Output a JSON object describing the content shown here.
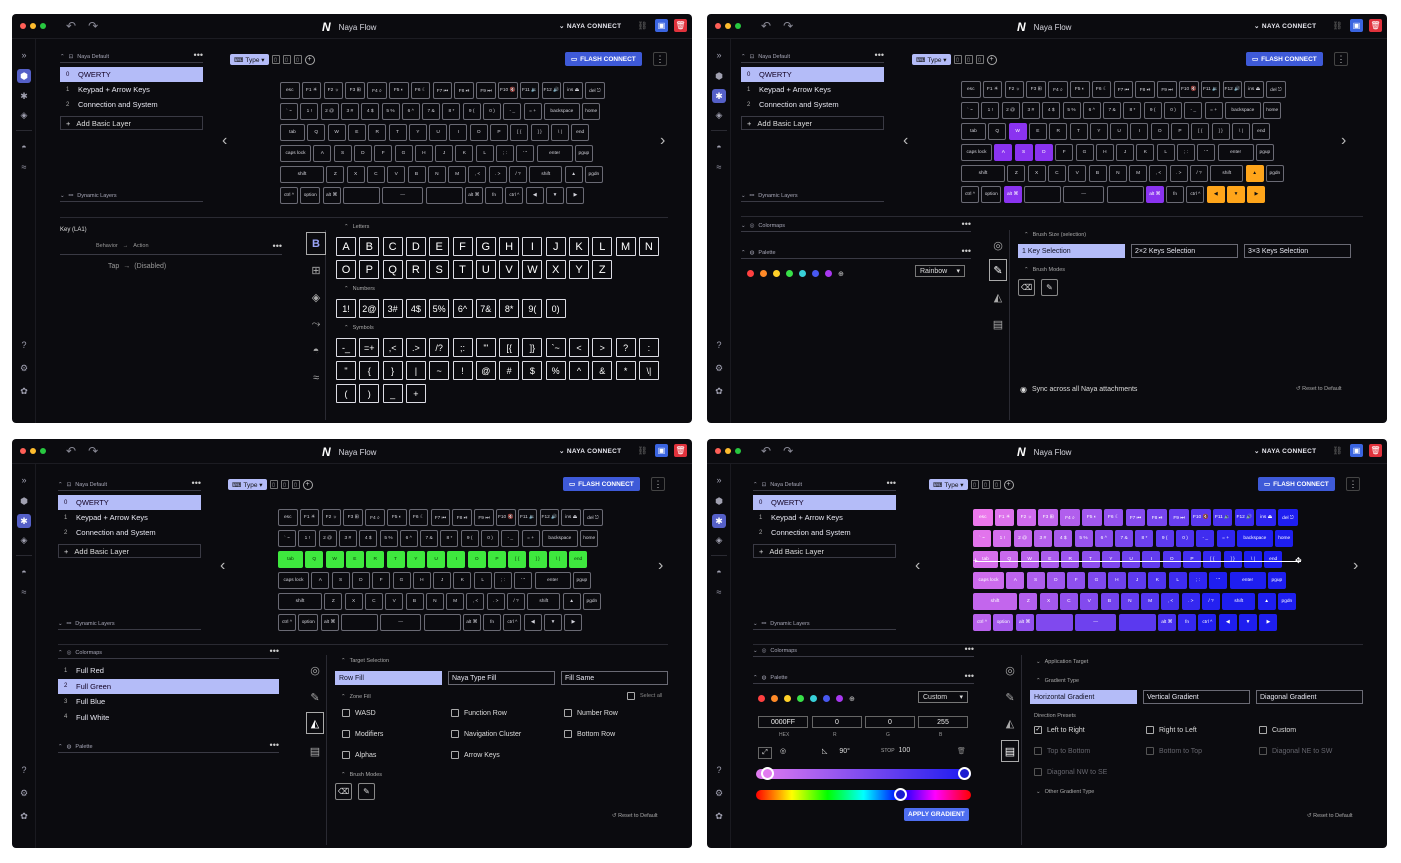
{
  "app": {
    "title": "Naya Flow",
    "logo": "N",
    "connect": "NAYA CONNECT",
    "flash": "FLASH CONNECT",
    "type_label": "Type",
    "collapse_icon": "»"
  },
  "panels": {
    "naya_default": "Naya Default",
    "dynamic_layers": "Dynamic Layers",
    "colormaps": "Colormaps",
    "palette": "Palette"
  },
  "layers": [
    {
      "n": "0",
      "label": "QWERTY"
    },
    {
      "n": "1",
      "label": "Keypad + Arrow Keys"
    },
    {
      "n": "2",
      "label": "Connection and System"
    }
  ],
  "add_layer": "Add Basic Layer",
  "keyboard": [
    [
      "esc",
      "F1 ☀",
      "F2 ☼",
      "F3 ⊞",
      "F4 ⌕",
      "F5 ◐",
      "F6 ☾",
      "F7 ⏮",
      "F8 ⏯",
      "F9 ⏭",
      "F10 🔇",
      "F11 🔉",
      "F12 🔊",
      "ins ⏏",
      "del ⎋"
    ],
    [
      "` ~",
      "1 !",
      "2 @",
      "3 #",
      "4 $",
      "5 %",
      "6 ^",
      "7 &",
      "8 *",
      "9 (",
      "0 )",
      "- _",
      "= +",
      "backspace",
      "home"
    ],
    [
      "tab",
      "Q",
      "W",
      "E",
      "R",
      "T",
      "Y",
      "U",
      "I",
      "O",
      "P",
      "[ {",
      "] }",
      "\\ |",
      "end"
    ],
    [
      "caps lock",
      "A",
      "S",
      "D",
      "F",
      "G",
      "H",
      "J",
      "K",
      "L",
      "; :",
      "' \"",
      "enter",
      "pgup"
    ],
    [
      "shift",
      "Z",
      "X",
      "C",
      "V",
      "B",
      "N",
      "M",
      ", <",
      ". >",
      "/ ?",
      "shift",
      "▲",
      "pgdn"
    ],
    [
      "ctrl ^",
      "option",
      "alt ⌘",
      "",
      "—",
      "",
      "alt ⌘",
      "fn",
      "ctrl ^",
      "◀",
      "▼",
      "▶"
    ]
  ],
  "w1": {
    "key_label": "Key (LA1)",
    "behavior": "Behavior",
    "action": "Action",
    "tap": "Tap",
    "tap_arrow": "→",
    "tap_value": "(Disabled)",
    "letters_title": "Letters",
    "numbers_title": "Numbers",
    "symbols_title": "Symbols",
    "tab_glyph": "B",
    "letters": [
      "A",
      "B",
      "C",
      "D",
      "E",
      "F",
      "G",
      "H",
      "I",
      "J",
      "K",
      "L",
      "M",
      "N",
      "O",
      "P",
      "Q",
      "R",
      "S",
      "T",
      "U",
      "V",
      "W",
      "X",
      "Y",
      "Z"
    ],
    "numbers": [
      "1!",
      "2@",
      "3#",
      "4$",
      "5%",
      "6^",
      "7&",
      "8*",
      "9(",
      "0)"
    ],
    "symbols": [
      "-_",
      "=+",
      ",<",
      ".>",
      "/?",
      ";:",
      "'\"",
      "[{",
      "]}",
      "`~",
      "<",
      ">",
      "?",
      ":",
      "\"",
      "{",
      "}",
      "|",
      "~",
      "!",
      "@",
      "#",
      "$",
      "%",
      "^",
      "&",
      "*",
      "\\|",
      "(",
      ")",
      "_",
      "+"
    ]
  },
  "w2": {
    "brush_size": "Brush Size (selection)",
    "sizes": [
      "1 Key Selection",
      "2×2 Keys Selection",
      "3×3 Keys Selection"
    ],
    "brush_modes": "Brush Modes",
    "palette_mode": "Rainbow",
    "sync": "Sync across all Naya attachments",
    "reset": "Reset to Default"
  },
  "w3": {
    "colormaps": [
      {
        "n": "1",
        "label": "Full Red"
      },
      {
        "n": "2",
        "label": "Full Green"
      },
      {
        "n": "3",
        "label": "Full Blue"
      },
      {
        "n": "4",
        "label": "Full White"
      }
    ],
    "target": "Target Selection",
    "targets": [
      "Row Fill",
      "Naya Type Fill",
      "Fill Same"
    ],
    "zone_fill": "Zone Fill",
    "select_all": "Select all",
    "zones": [
      "WASD",
      "Function Row",
      "Number Row",
      "Modifiers",
      "Navigation Cluster",
      "Bottom Row",
      "Alphas",
      "Arrow Keys"
    ],
    "brush_modes": "Brush Modes",
    "reset": "Reset to Default"
  },
  "w4": {
    "app_target": "Application Target",
    "gradient_type": "Gradient Type",
    "types": [
      "Horizontal Gradient",
      "Vertical Gradient",
      "Diagonal Gradient"
    ],
    "direction": "Direction Presets",
    "directions": [
      "Left to Right",
      "Right to Left",
      "Custom",
      "Top to Bottom",
      "Bottom to Top",
      "Diagonal NE to SW",
      "Diagonal NW to SE"
    ],
    "other": "Other Gradient Type",
    "palette_mode": "Custom",
    "hex": "0000FF",
    "r": "0",
    "g": "0",
    "b": "255",
    "hex_l": "HEX",
    "r_l": "R",
    "g_l": "G",
    "b_l": "B",
    "angle": "90°",
    "stop_l": "STOP",
    "stop": "100",
    "apply": "APPLY GRADIENT",
    "reset": "Reset to Default"
  },
  "colors": {
    "accent": "#b4bcf8",
    "flash": "#3e5ad8",
    "green": "#3ee83e",
    "purple": "#8a33f0",
    "orange": "#ffa51a"
  }
}
